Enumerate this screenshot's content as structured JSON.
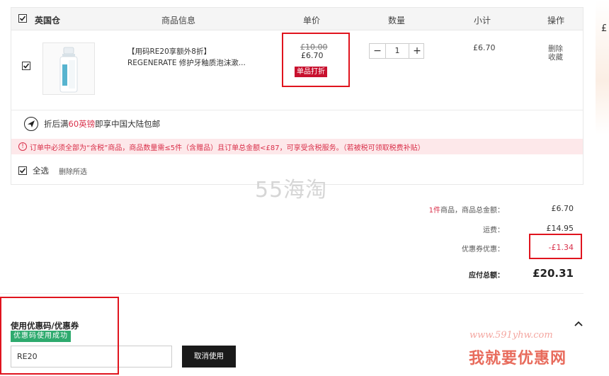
{
  "header": {
    "warehouse": "英国仓",
    "product_info": "商品信息",
    "unit_price": "单价",
    "quantity": "数量",
    "subtotal": "小计",
    "actions": "操作"
  },
  "item": {
    "title": "【用码RE20享额外8折】",
    "name": "REGENERATE 修护牙釉质泡沫漱...",
    "original_price": "£10.00",
    "price": "£6.70",
    "discount_badge": "单品打折",
    "quantity": "1",
    "minus": "−",
    "plus": "+",
    "subtotal": "£6.70",
    "action_delete": "删除",
    "action_favorite": "收藏"
  },
  "shipping_note": {
    "prefix": "折后满",
    "highlight": "60英镑",
    "suffix": "即享中国大陆包邮"
  },
  "warning": {
    "icon": "!",
    "text": "订单中必须全部为“含税”商品，商品数量需≤5件（含赠品）且订单总金额<£87，可享受含税服务。（若被税可领取税费补贴）"
  },
  "select_all": {
    "label": "全选",
    "delete_selected": "删除所选"
  },
  "summary": {
    "items_count": "1件",
    "items_label": "商品，商品总金额：",
    "items_total": "£6.70",
    "shipping_label": "运费：",
    "shipping": "£14.95",
    "coupon_label": "优惠券优惠：",
    "coupon_discount": "-£1.34",
    "total_label": "应付总额：",
    "total": "£20.31"
  },
  "coupon": {
    "title": "使用优惠码/优惠券",
    "success": "优惠码使用成功",
    "code": "RE20",
    "cancel_label": "取消使用"
  },
  "side": {
    "pound": "£"
  },
  "watermarks": {
    "site_55": "55海淘",
    "url": "www.591yhw.com",
    "brand": "我就要优惠网"
  },
  "colors": {
    "accent_red": "#d9304a",
    "badge_red": "#c8102e",
    "success_green": "#2eaa6e",
    "highlight_box": "#e0141e"
  }
}
